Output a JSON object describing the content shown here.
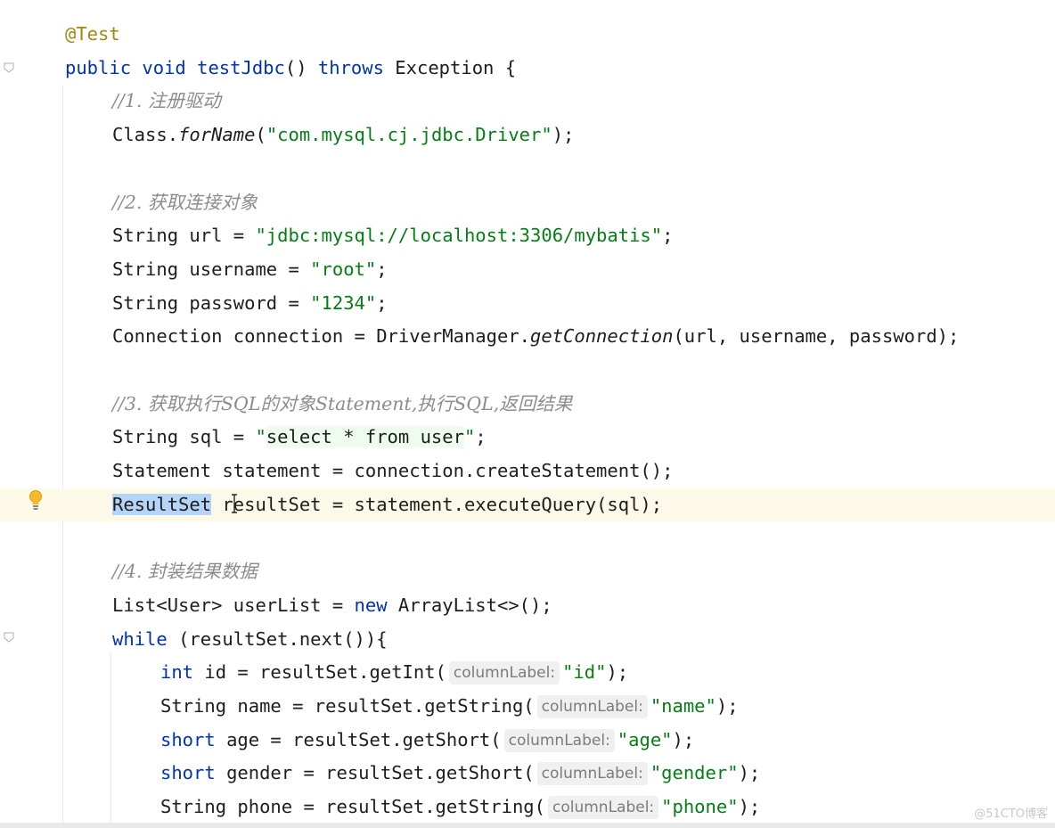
{
  "editor": {
    "lines": [
      {
        "tokens": [
          {
            "t": "@Test",
            "c": "ann"
          }
        ]
      },
      {
        "tokens": [
          {
            "t": "public void ",
            "c": "kw"
          },
          {
            "t": "testJdbc",
            "c": "kw"
          },
          {
            "t": "() "
          },
          {
            "t": "throws ",
            "c": "kw"
          },
          {
            "t": "Exception {"
          }
        ]
      },
      {
        "tokens": [
          {
            "t": "//1. 注册驱动",
            "c": "cmt"
          }
        ]
      },
      {
        "tokens": [
          {
            "t": "Class."
          },
          {
            "t": "forName",
            "c": "it"
          },
          {
            "t": "("
          },
          {
            "t": "\"com.mysql.cj.jdbc.Driver\"",
            "c": "str"
          },
          {
            "t": ");"
          }
        ]
      },
      {
        "tokens": []
      },
      {
        "tokens": [
          {
            "t": "//2. 获取连接对象",
            "c": "cmt"
          }
        ]
      },
      {
        "tokens": [
          {
            "t": "String url = "
          },
          {
            "t": "\"jdbc:mysql://localhost:3306/mybatis\"",
            "c": "str"
          },
          {
            "t": ";"
          }
        ]
      },
      {
        "tokens": [
          {
            "t": "String username = "
          },
          {
            "t": "\"root\"",
            "c": "str"
          },
          {
            "t": ";"
          }
        ]
      },
      {
        "tokens": [
          {
            "t": "String password = "
          },
          {
            "t": "\"1234\"",
            "c": "str"
          },
          {
            "t": ";"
          }
        ]
      },
      {
        "tokens": [
          {
            "t": "Connection connection = DriverManager."
          },
          {
            "t": "getConnection",
            "c": "it"
          },
          {
            "t": "(url, username, password);"
          }
        ]
      },
      {
        "tokens": []
      },
      {
        "tokens": [
          {
            "t": "//3. 获取执行SQL的对象Statement,执行SQL,返回结果",
            "c": "cmt"
          }
        ]
      },
      {
        "tokens": [
          {
            "t": "String sql = "
          },
          {
            "t": "\"",
            "c": "str"
          },
          {
            "t": "select * from user",
            "c": "inj"
          },
          {
            "t": "\"",
            "c": "str"
          },
          {
            "t": ";"
          }
        ]
      },
      {
        "tokens": [
          {
            "t": "Statement statement = connection.createStatement();"
          }
        ]
      },
      {
        "tokens": [
          {
            "t": "ResultSet",
            "c": "sel"
          },
          {
            "t": " resultSet = statement.executeQuery(sql);"
          }
        ]
      },
      {
        "tokens": []
      },
      {
        "tokens": [
          {
            "t": "//4. 封装结果数据",
            "c": "cmt"
          }
        ]
      },
      {
        "tokens": [
          {
            "t": "List<User> userList = "
          },
          {
            "t": "new ",
            "c": "kw"
          },
          {
            "t": "ArrayList<>();"
          }
        ]
      },
      {
        "tokens": [
          {
            "t": "while ",
            "c": "kw"
          },
          {
            "t": "(resultSet.next()){"
          }
        ]
      },
      {
        "tokens": [
          {
            "t": "int ",
            "c": "kw"
          },
          {
            "t": "id = resultSet.getInt("
          },
          {
            "t": "columnLabel:",
            "c": "hint"
          },
          {
            "t": "\"id\"",
            "c": "str"
          },
          {
            "t": ");"
          }
        ]
      },
      {
        "tokens": [
          {
            "t": "String name = resultSet.getString("
          },
          {
            "t": "columnLabel:",
            "c": "hint"
          },
          {
            "t": "\"name\"",
            "c": "str"
          },
          {
            "t": ");"
          }
        ]
      },
      {
        "tokens": [
          {
            "t": "short ",
            "c": "kw"
          },
          {
            "t": "age = resultSet.getShort("
          },
          {
            "t": "columnLabel:",
            "c": "hint"
          },
          {
            "t": "\"age\"",
            "c": "str"
          },
          {
            "t": ");"
          }
        ]
      },
      {
        "tokens": [
          {
            "t": "short ",
            "c": "kw"
          },
          {
            "t": "gender = resultSet.getShort("
          },
          {
            "t": "columnLabel:",
            "c": "hint"
          },
          {
            "t": "\"gender\"",
            "c": "str"
          },
          {
            "t": ");"
          }
        ]
      },
      {
        "tokens": [
          {
            "t": "String phone = resultSet.getString("
          },
          {
            "t": "columnLabel:",
            "c": "hint"
          },
          {
            "t": "\"phone\"",
            "c": "str"
          },
          {
            "t": ");"
          }
        ]
      }
    ]
  },
  "icons": {
    "intention_bulb": "lightbulb-icon",
    "fold_marker": "fold-arrow-icon"
  },
  "watermark": "@51CTO博客",
  "colors": {
    "keyword": "#0033b3",
    "string": "#067d17",
    "comment": "#8c8c8c",
    "annotation": "#9e880d",
    "selection": "#b4d4f8",
    "caret_line": "#fdf9e8"
  }
}
